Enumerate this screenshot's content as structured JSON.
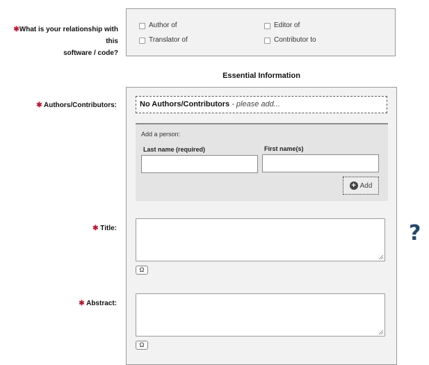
{
  "relationship": {
    "label_line1": "What is your relationship with this",
    "label_line2": "software / code?",
    "options": [
      "Author of",
      "Editor of",
      "Translator of",
      "Contributor to"
    ]
  },
  "section_title": "Essential Information",
  "authors": {
    "label": "Authors/Contributors:",
    "empty_bold": "No Authors/Contributors",
    "empty_italic": " - please add..."
  },
  "add_person": {
    "heading": "Add a person:",
    "last_name_label": "Last name (required)",
    "first_name_label": "First name(s)",
    "add_button": "Add"
  },
  "title_field": {
    "label": "Title:",
    "omega": "Ω"
  },
  "abstract_field": {
    "label": "Abstract:",
    "omega": "Ω"
  },
  "help": {
    "symbol": "?"
  },
  "required_marker": "✱",
  "colors": {
    "required": "#c8102e",
    "help": "#22486e",
    "panel_bg": "#f2f2f2"
  }
}
